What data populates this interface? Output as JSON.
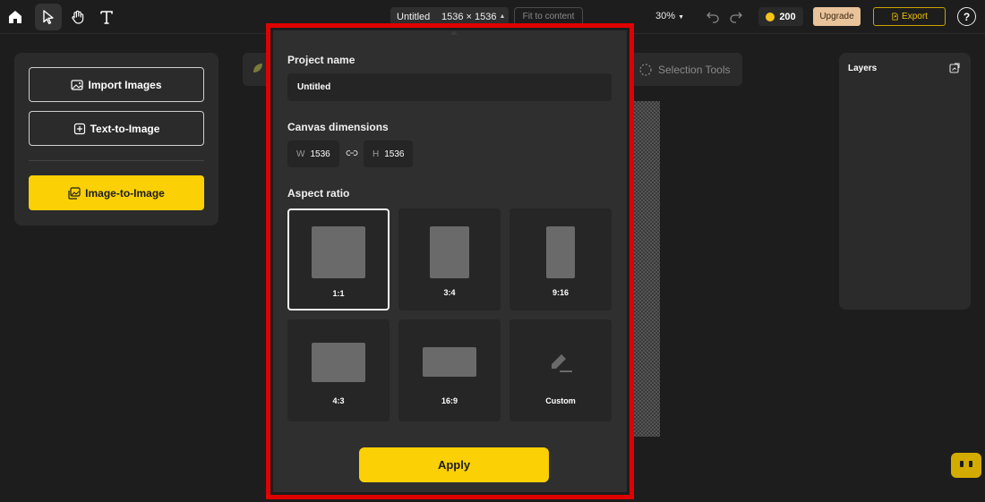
{
  "topbar": {
    "project_title": "Untitled",
    "canvas_size": "1536 × 1536",
    "fit_label": "Fit to content",
    "zoom": "30%",
    "credits": "200",
    "upgrade_label": "Upgrade",
    "export_label": "Export",
    "help_label": "?"
  },
  "left_panel": {
    "import_label": "Import Images",
    "text_to_image_label": "Text-to-Image",
    "image_to_image_label": "Image-to-Image"
  },
  "toolbar": {
    "selection_tools_label": "Selection Tools"
  },
  "layers": {
    "title": "Layers"
  },
  "modal": {
    "project_name_label": "Project name",
    "project_name_value": "Untitled",
    "canvas_dimensions_label": "Canvas dimensions",
    "width_key": "W",
    "width_value": "1536",
    "height_key": "H",
    "height_value": "1536",
    "aspect_ratio_label": "Aspect ratio",
    "ratios": [
      {
        "label": "1:1",
        "selected": true
      },
      {
        "label": "3:4",
        "selected": false
      },
      {
        "label": "9:16",
        "selected": false
      },
      {
        "label": "4:3",
        "selected": false
      },
      {
        "label": "16:9",
        "selected": false
      },
      {
        "label": "Custom",
        "selected": false
      }
    ],
    "apply_label": "Apply"
  },
  "colors": {
    "accent_yellow": "#fbd004",
    "highlight_red": "#e00000",
    "background": "#1d1d1d",
    "panel": "#2b2b2b"
  }
}
